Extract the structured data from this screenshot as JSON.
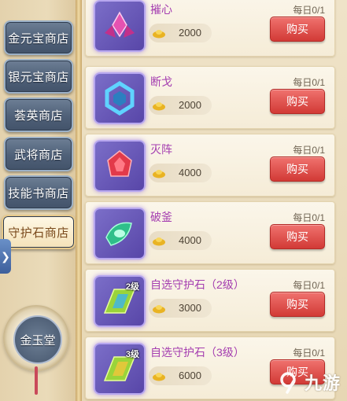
{
  "sidebar": {
    "tabs": [
      {
        "label": "金元宝商店"
      },
      {
        "label": "银元宝商店"
      },
      {
        "label": "荟英商店"
      },
      {
        "label": "武将商店"
      },
      {
        "label": "技能书商店"
      },
      {
        "label": "守护石商店"
      }
    ],
    "active_tab_index": 5,
    "bottom_button": "金玉堂",
    "expand_icon": "chevron-right-icon"
  },
  "items": [
    {
      "name": "摧心",
      "limit": "每日0/1",
      "price": "2000",
      "currency_icon": "gold-ingot-icon",
      "buy_label": "购买",
      "gem_color": "#d63f9a"
    },
    {
      "name": "断戈",
      "limit": "每日0/1",
      "price": "2000",
      "currency_icon": "gold-ingot-icon",
      "buy_label": "购买",
      "gem_color": "#3fa7d6"
    },
    {
      "name": "灭阵",
      "limit": "每日0/1",
      "price": "4000",
      "currency_icon": "gold-ingot-icon",
      "buy_label": "购买",
      "gem_color": "#d6343f"
    },
    {
      "name": "破釜",
      "limit": "每日0/1",
      "price": "4000",
      "currency_icon": "gold-ingot-icon",
      "buy_label": "购买",
      "gem_color": "#2fbf8a"
    },
    {
      "name": "自选守护石（2级）",
      "limit": "每日0/1",
      "price": "3000",
      "currency_icon": "gold-ingot-icon",
      "buy_label": "购买",
      "badge": "2级",
      "gem_color": "#a6d63f"
    },
    {
      "name": "自选守护石（3级）",
      "limit": "每日0/1",
      "price": "6000",
      "currency_icon": "gold-ingot-icon",
      "buy_label": "购买",
      "badge": "3级",
      "gem_color": "#a6d63f"
    }
  ],
  "watermark": {
    "text": "九游",
    "logo": "9-logo-icon"
  }
}
